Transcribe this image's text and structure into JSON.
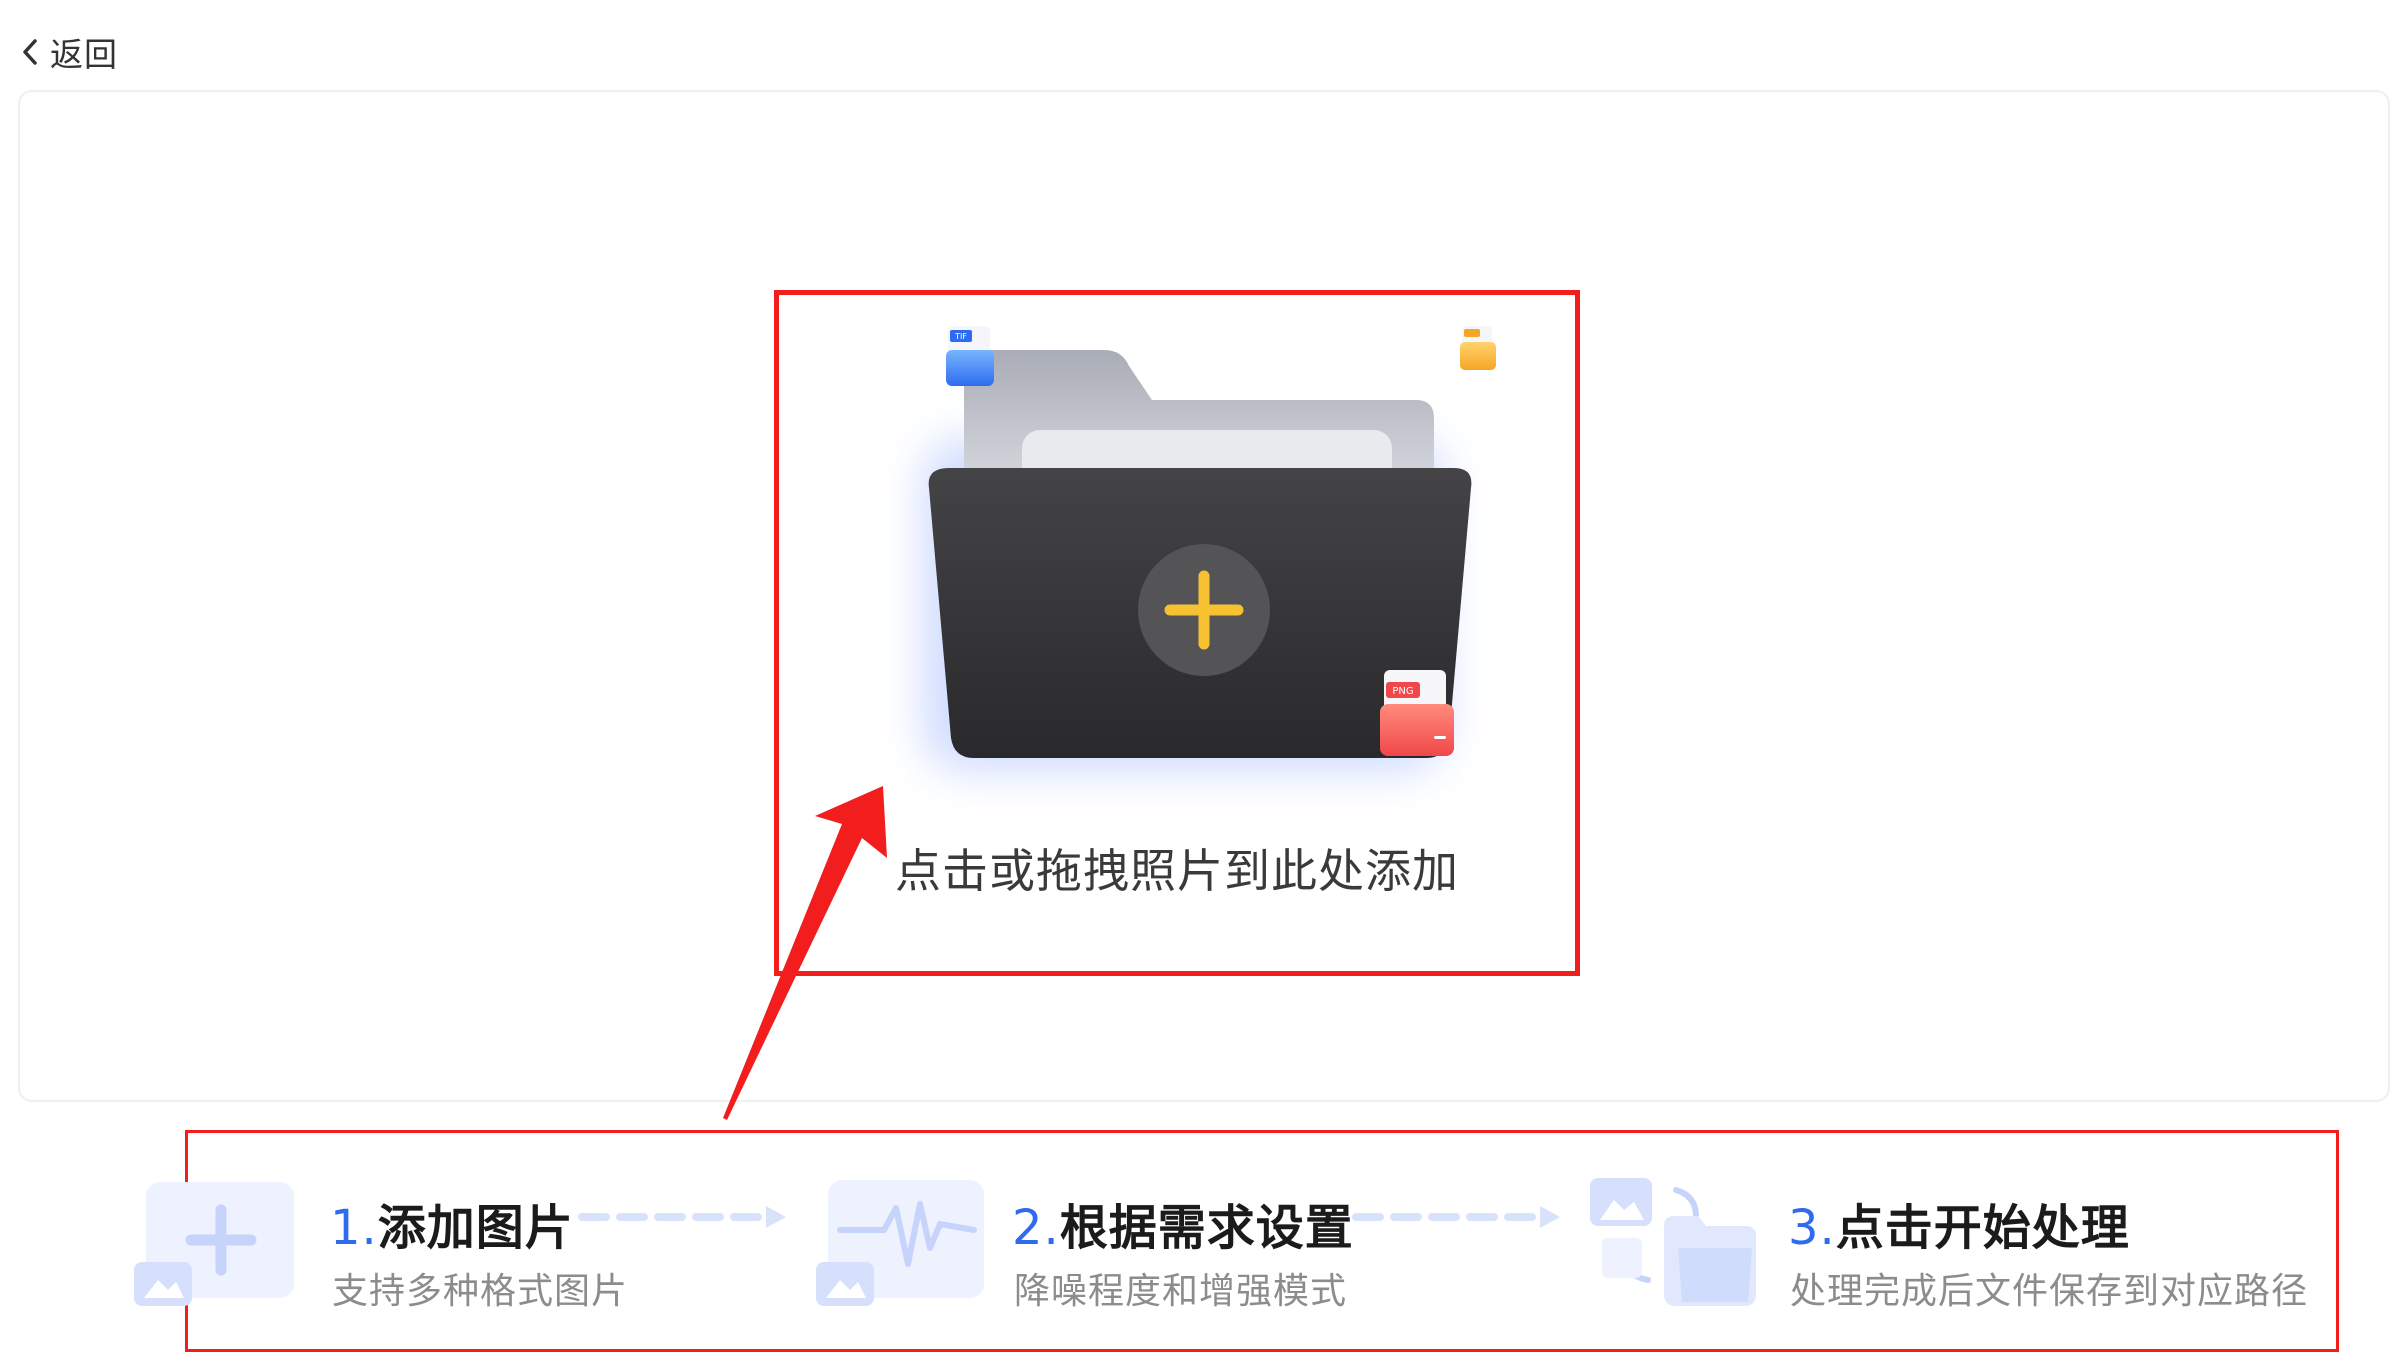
{
  "back": {
    "label": "返回"
  },
  "upload": {
    "prompt": "点击或拖拽照片到此处添加",
    "badges": [
      "TIF",
      "PNG"
    ]
  },
  "steps": [
    {
      "number": "1.",
      "title": "添加图片",
      "description": "支持多种格式图片",
      "icon": "add-image-icon"
    },
    {
      "number": "2.",
      "title": "根据需求设置",
      "description": "降噪程度和增强模式",
      "icon": "waveform-settings-icon"
    },
    {
      "number": "3.",
      "title": "点击开始处理",
      "description": "处理完成后文件保存到对应路径",
      "icon": "image-to-folder-icon"
    }
  ],
  "colors": {
    "accent_blue": "#2f6bf0",
    "annotation_red": "#f21d1d",
    "folder_dark": "#3b3b3d",
    "plus_yellow": "#f7c231"
  }
}
